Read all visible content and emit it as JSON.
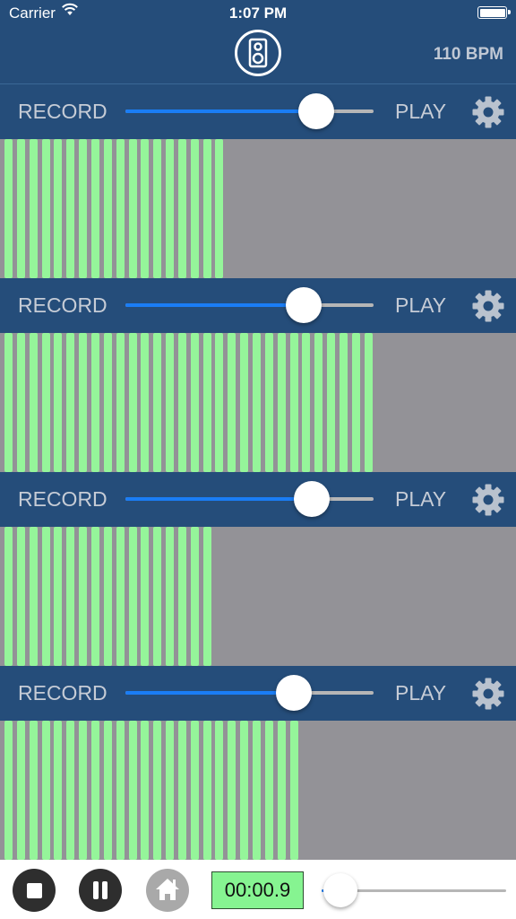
{
  "status_bar": {
    "carrier": "Carrier",
    "time": "1:07 PM"
  },
  "header": {
    "logo_icon": "speaker-icon",
    "bpm": "110 BPM"
  },
  "colors": {
    "bar_blue": "#254d7a",
    "wave_gray": "#939297",
    "wave_green": "#95f59a",
    "slider_blue": "#1a7df5",
    "timer_green": "#86f491"
  },
  "tracks": [
    {
      "record_label": "RECORD",
      "play_label": "PLAY",
      "slider_value": 0.77,
      "bar_count": 18,
      "settings_icon": "gear-icon"
    },
    {
      "record_label": "RECORD",
      "play_label": "PLAY",
      "slider_value": 0.72,
      "bar_count": 30,
      "settings_icon": "gear-icon"
    },
    {
      "record_label": "RECORD",
      "play_label": "PLAY",
      "slider_value": 0.75,
      "bar_count": 17,
      "settings_icon": "gear-icon"
    },
    {
      "record_label": "RECORD",
      "play_label": "PLAY",
      "slider_value": 0.68,
      "bar_count": 24,
      "settings_icon": "gear-icon"
    }
  ],
  "transport": {
    "stop_icon": "stop-icon",
    "pause_icon": "pause-icon",
    "home_icon": "home-icon",
    "timer": "00:00.9",
    "master_slider_value": 0.1
  }
}
